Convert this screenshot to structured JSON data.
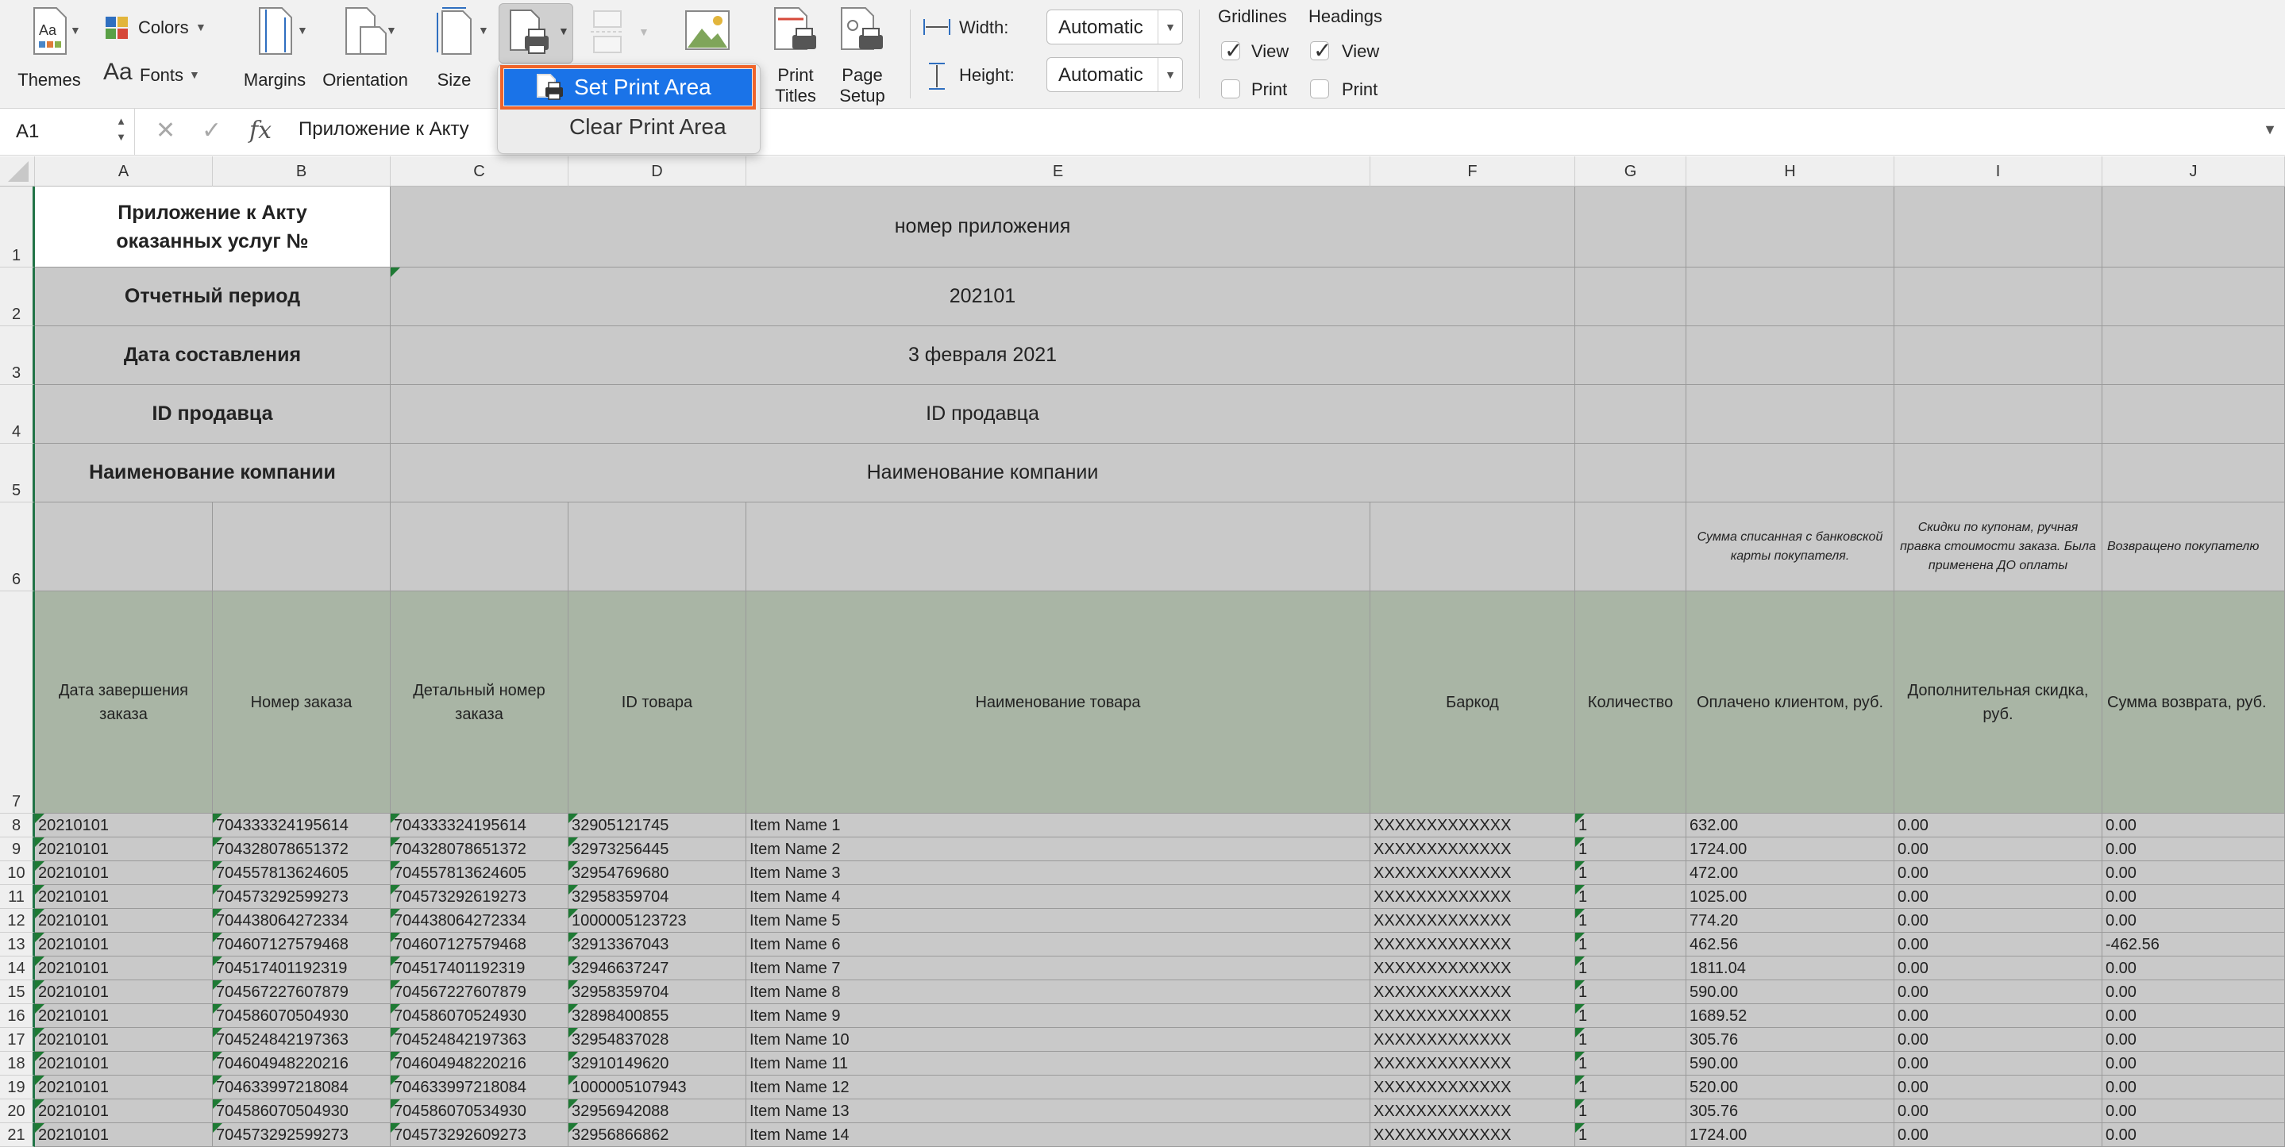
{
  "ribbon": {
    "themes": "Themes",
    "colors": "Colors",
    "fonts": "Fonts",
    "margins": "Margins",
    "orientation": "Orientation",
    "size": "Size",
    "print_titles": "Print\nTitles",
    "page_setup": "Page\nSetup",
    "width_label": "Width:",
    "width_value": "Automatic",
    "height_label": "Height:",
    "height_value": "Automatic",
    "gridlines": "Gridlines",
    "headings": "Headings",
    "gridlines_view": "View",
    "gridlines_print": "Print",
    "headings_view": "View",
    "headings_print": "Print",
    "gridlines_view_checked": true,
    "gridlines_print_checked": false,
    "headings_view_checked": true,
    "headings_print_checked": false
  },
  "menu": {
    "set_print_area": "Set Print Area",
    "clear_print_area": "Clear Print Area"
  },
  "formula_bar": {
    "name_box": "A1",
    "content": "Приложение к Акту"
  },
  "columns": [
    "A",
    "B",
    "C",
    "D",
    "E",
    "F",
    "G",
    "H",
    "I",
    "J"
  ],
  "rows": [
    "1",
    "2",
    "3",
    "4",
    "5",
    "6",
    "7",
    "8",
    "9",
    "10",
    "11",
    "12",
    "13",
    "14",
    "15",
    "16",
    "17",
    "18",
    "19",
    "20",
    "21"
  ],
  "header_block": {
    "r1_label": "Приложение к Акту\nоказанных услуг №",
    "r1_value": "номер приложения",
    "r2_label": "Отчетный период",
    "r2_value": "202101",
    "r3_label": "Дата составления",
    "r3_value": "3 февраля 2021",
    "r4_label": "ID продавца",
    "r4_value": "ID продавца",
    "r5_label": "Наименование компании",
    "r5_value": "Наименование компании"
  },
  "notes_row6": {
    "H": "Сумма списанная с банковской карты покупателя.",
    "I": "Скидки по купонам, ручная правка стоимости заказа. Была применена ДО оплаты",
    "J": "Возвращено покупателю"
  },
  "table_headers": [
    "Дата завершения заказа",
    "Номер заказа",
    "Детальный номер заказа",
    "ID товара",
    "Наименование товара",
    "Баркод",
    "Количество",
    "Оплачено клиентом, руб.",
    "Дополнительная скидка, руб.",
    "Сумма возврата, руб."
  ],
  "table_rows": [
    [
      "20210101",
      "704333324195614",
      "704333324195614",
      "32905121745",
      "Item Name 1",
      "XXXXXXXXXXXXX",
      "1",
      "632.00",
      "0.00",
      "0.00"
    ],
    [
      "20210101",
      "704328078651372",
      "704328078651372",
      "32973256445",
      "Item Name 2",
      "XXXXXXXXXXXXX",
      "1",
      "1724.00",
      "0.00",
      "0.00"
    ],
    [
      "20210101",
      "704557813624605",
      "704557813624605",
      "32954769680",
      "Item Name 3",
      "XXXXXXXXXXXXX",
      "1",
      "472.00",
      "0.00",
      "0.00"
    ],
    [
      "20210101",
      "704573292599273",
      "704573292619273",
      "32958359704",
      "Item Name 4",
      "XXXXXXXXXXXXX",
      "1",
      "1025.00",
      "0.00",
      "0.00"
    ],
    [
      "20210101",
      "704438064272334",
      "704438064272334",
      "1000005123723",
      "Item Name 5",
      "XXXXXXXXXXXXX",
      "1",
      "774.20",
      "0.00",
      "0.00"
    ],
    [
      "20210101",
      "704607127579468",
      "704607127579468",
      "32913367043",
      "Item Name 6",
      "XXXXXXXXXXXXX",
      "1",
      "462.56",
      "0.00",
      "-462.56"
    ],
    [
      "20210101",
      "704517401192319",
      "704517401192319",
      "32946637247",
      "Item Name 7",
      "XXXXXXXXXXXXX",
      "1",
      "1811.04",
      "0.00",
      "0.00"
    ],
    [
      "20210101",
      "704567227607879",
      "704567227607879",
      "32958359704",
      "Item Name 8",
      "XXXXXXXXXXXXX",
      "1",
      "590.00",
      "0.00",
      "0.00"
    ],
    [
      "20210101",
      "704586070504930",
      "704586070524930",
      "32898400855",
      "Item Name 9",
      "XXXXXXXXXXXXX",
      "1",
      "1689.52",
      "0.00",
      "0.00"
    ],
    [
      "20210101",
      "704524842197363",
      "704524842197363",
      "32954837028",
      "Item Name 10",
      "XXXXXXXXXXXXX",
      "1",
      "305.76",
      "0.00",
      "0.00"
    ],
    [
      "20210101",
      "704604948220216",
      "704604948220216",
      "32910149620",
      "Item Name 11",
      "XXXXXXXXXXXXX",
      "1",
      "590.00",
      "0.00",
      "0.00"
    ],
    [
      "20210101",
      "704633997218084",
      "704633997218084",
      "1000005107943",
      "Item Name 12",
      "XXXXXXXXXXXXX",
      "1",
      "520.00",
      "0.00",
      "0.00"
    ],
    [
      "20210101",
      "704586070504930",
      "704586070534930",
      "32956942088",
      "Item Name 13",
      "XXXXXXXXXXXXX",
      "1",
      "305.76",
      "0.00",
      "0.00"
    ],
    [
      "20210101",
      "704573292599273",
      "704573292609273",
      "32956866862",
      "Item Name 14",
      "XXXXXXXXXXXXX",
      "1",
      "1724.00",
      "0.00",
      "0.00"
    ]
  ]
}
